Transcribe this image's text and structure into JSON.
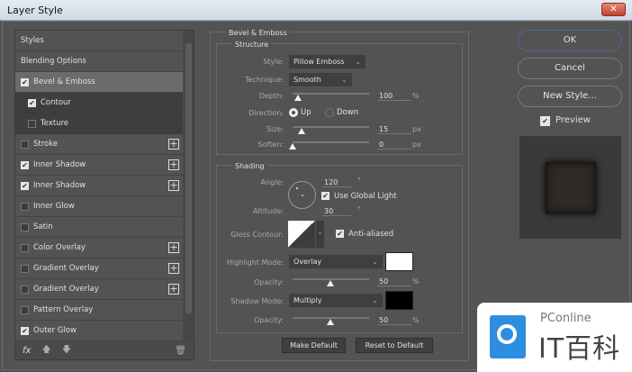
{
  "window": {
    "title": "Layer Style",
    "close": "✕"
  },
  "sidebar": {
    "items": [
      {
        "label": "Styles"
      },
      {
        "label": "Blending Options"
      },
      {
        "label": "Bevel & Emboss",
        "checked": true
      },
      {
        "label": "Contour",
        "checked": true
      },
      {
        "label": "Texture",
        "checked": false
      },
      {
        "label": "Stroke",
        "checked": false
      },
      {
        "label": "Inner Shadow",
        "checked": true
      },
      {
        "label": "Inner Shadow",
        "checked": true
      },
      {
        "label": "Inner Glow",
        "checked": false
      },
      {
        "label": "Satin",
        "checked": false
      },
      {
        "label": "Color Overlay",
        "checked": false
      },
      {
        "label": "Gradient Overlay",
        "checked": false
      },
      {
        "label": "Gradient Overlay",
        "checked": false
      },
      {
        "label": "Pattern Overlay",
        "checked": false
      },
      {
        "label": "Outer Glow",
        "checked": true
      }
    ],
    "fx": "fx",
    "up": "🡅",
    "down": "🡇",
    "trash": "🗑"
  },
  "bevel": {
    "title": "Bevel & Emboss",
    "structure": {
      "title": "Structure",
      "style_label": "Style:",
      "style": "Pillow Emboss",
      "technique_label": "Technique:",
      "technique": "Smooth",
      "depth_label": "Depth:",
      "depth": "100",
      "depth_unit": "%",
      "direction_label": "Direction:",
      "up": "Up",
      "down": "Down",
      "size_label": "Size:",
      "size": "15",
      "size_unit": "px",
      "soften_label": "Soften:",
      "soften": "0",
      "soften_unit": "px"
    },
    "shading": {
      "title": "Shading",
      "angle_label": "Angle:",
      "angle": "120",
      "deg": "°",
      "global_light": "Use Global Light",
      "altitude_label": "Altitude:",
      "altitude": "30",
      "gloss_label": "Gloss Contour:",
      "anti_aliased": "Anti-aliased",
      "highlight_label": "Highlight Mode:",
      "highlight_mode": "Overlay",
      "highlight_color": "#ffffff",
      "opacity_label": "Opacity:",
      "highlight_opacity": "50",
      "pct": "%",
      "shadow_label": "Shadow Mode:",
      "shadow_mode": "Multiply",
      "shadow_color": "#000000",
      "shadow_opacity": "50"
    },
    "make_default": "Make Default",
    "reset_default": "Reset to Default"
  },
  "actions": {
    "ok": "OK",
    "cancel": "Cancel",
    "new_style": "New Style...",
    "preview": "Preview"
  },
  "watermark": {
    "brand": "PConline",
    "cn": "IT百科"
  }
}
